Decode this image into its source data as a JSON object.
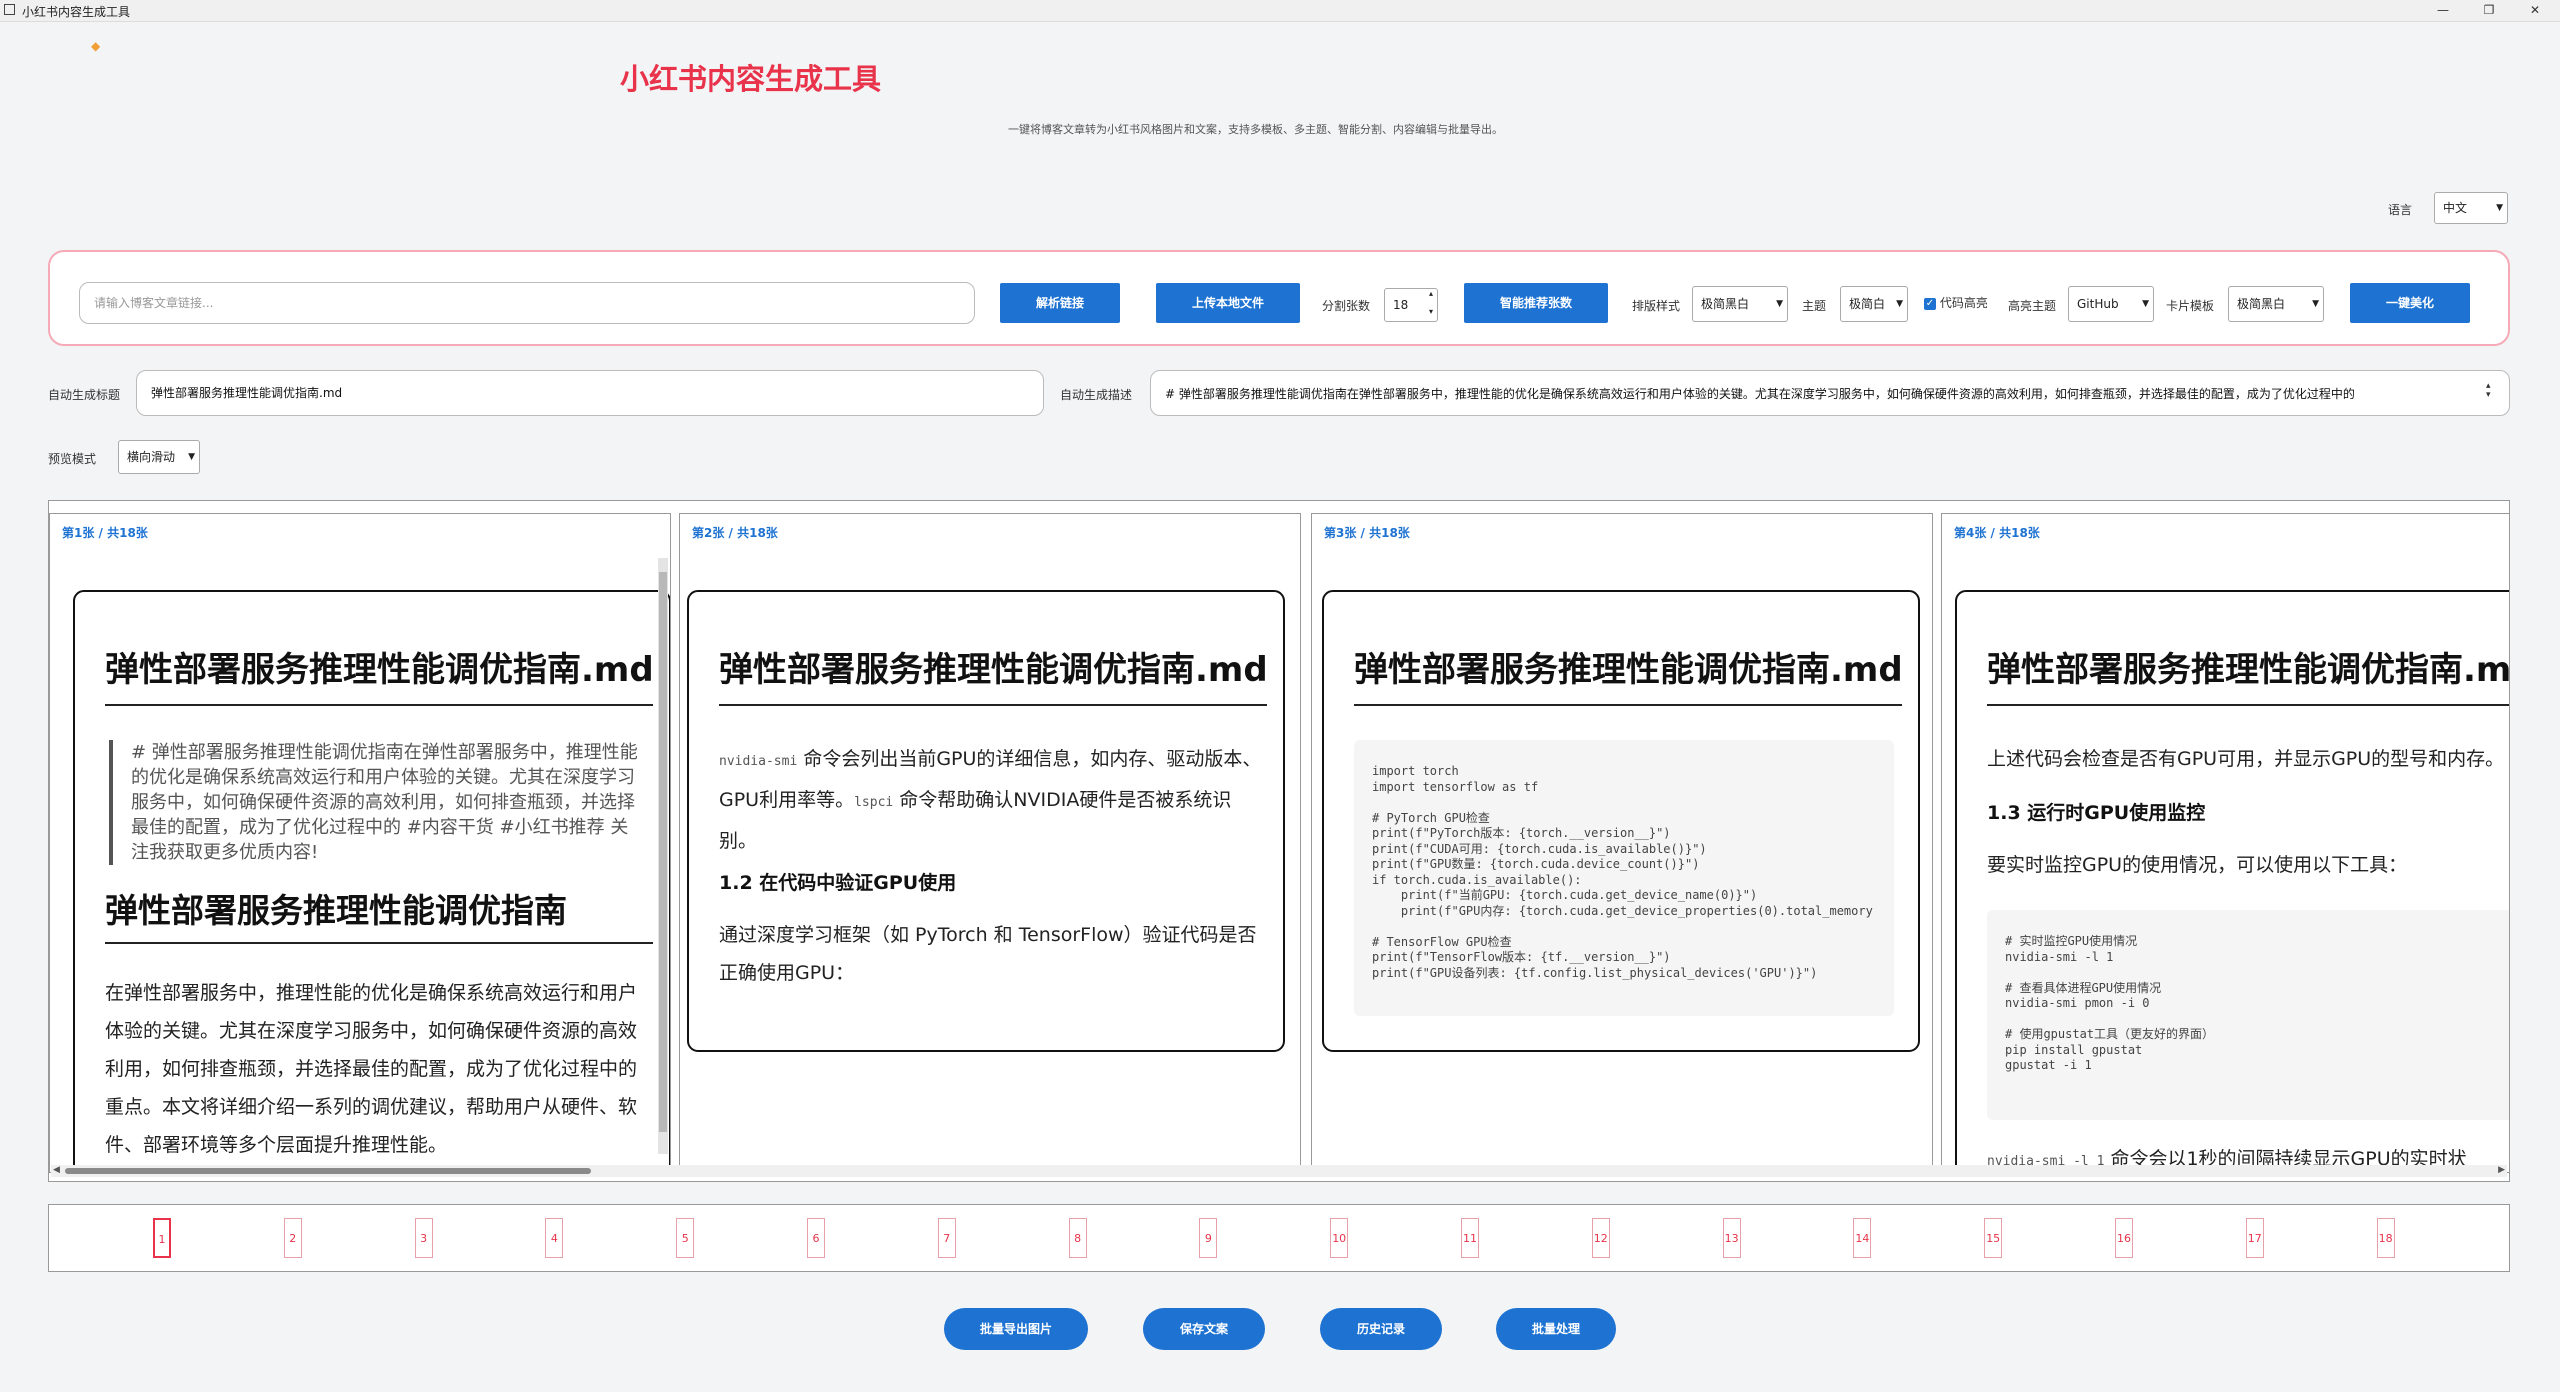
{
  "window": {
    "title": "小红书内容生成工具"
  },
  "header": {
    "logo": "◆",
    "title": "小红书内容生成工具",
    "subtitle": "一键将博客文章转为小红书风格图片和文案，支持多模板、多主题、智能分割、内容编辑与批量导出。"
  },
  "language": {
    "label": "语言",
    "value": "中文"
  },
  "toolbar": {
    "url_placeholder": "请输入博客文章链接...",
    "parse_btn": "解析链接",
    "upload_btn": "上传本地文件",
    "split_label": "分割张数",
    "split_value": "18",
    "recommend_btn": "智能推荐张数",
    "layout_label": "排版样式",
    "layout_value": "极简黑白",
    "theme_label": "主题",
    "theme_value": "极简白",
    "code_highlight_label": "代码高亮",
    "code_highlight_checked": true,
    "hl_theme_label": "高亮主题",
    "hl_theme_value": "GitHub",
    "card_template_label": "卡片模板",
    "card_template_value": "极简黑白",
    "beautify_btn": "一键美化"
  },
  "auto": {
    "title_label": "自动生成标题",
    "title_value": "弹性部署服务推理性能调优指南.md",
    "desc_label": "自动生成描述",
    "desc_value": "# 弹性部署服务推理性能调优指南在弹性部署服务中，推理性能的优化是确保系统高效运行和用户体验的关键。尤其在深度学习服务中，如何确保硬件资源的高效利用，如何排查瓶颈，并选择最佳的配置，成为了优化过程中的"
  },
  "preview_mode": {
    "label": "预览模式",
    "value": "横向滑动"
  },
  "cards": [
    {
      "header": "第1张 / 共18张",
      "title": "弹性部署服务推理性能调优指南.md",
      "quote": "# 弹性部署服务推理性能调优指南在弹性部署服务中，推理性能的优化是确保系统高效运行和用户体验的关键。尤其在深度学习服务中，如何确保硬件资源的高效利用，如何排查瓶颈，并选择最佳的配置，成为了优化过程中的 #内容干货 #小红书推荐 关注我获取更多优质内容!",
      "h2": "弹性部署服务推理性能调优指南",
      "para": "在弹性部署服务中，推理性能的优化是确保系统高效运行和用户体验的关键。尤其在深度学习服务中，如何确保硬件资源的高效利用，如何排查瓶颈，并选择最佳的配置，成为了优化过程中的重点。本文将详细介绍一系列的调优建议，帮助用户从硬件、软件、部署环境等多个层面提升推理性能。"
    },
    {
      "header": "第2张 / 共18张",
      "title": "弹性部署服务推理性能调优指南.md",
      "p1_code1": "nvidia-smi",
      "p1_text1": " 命令会列出当前GPU的详细信息，如内存、驱动版本、GPU利用率等。",
      "p1_code2": "lspci",
      "p1_text2": " 命令帮助确认NVIDIA硬件是否被系统识别。",
      "h3": "1.2 在代码中验证GPU使用",
      "para": "通过深度学习框架（如 PyTorch 和 TensorFlow）验证代码是否正确使用GPU："
    },
    {
      "header": "第3张 / 共18张",
      "title": "弹性部署服务推理性能调优指南.md",
      "code": "import torch\nimport tensorflow as tf\n\n# PyTorch GPU检查\nprint(f\"PyTorch版本: {torch.__version__}\")\nprint(f\"CUDA可用: {torch.cuda.is_available()}\")\nprint(f\"GPU数量: {torch.cuda.device_count()}\")\nif torch.cuda.is_available():\n    print(f\"当前GPU: {torch.cuda.get_device_name(0)}\")\n    print(f\"GPU内存: {torch.cuda.get_device_properties(0).total_memory\n\n# TensorFlow GPU检查\nprint(f\"TensorFlow版本: {tf.__version__}\")\nprint(f\"GPU设备列表: {tf.config.list_physical_devices('GPU')}\")"
    },
    {
      "header": "第4张 / 共18张",
      "title": "弹性部署服务推理性能调优指南.md",
      "p1": "上述代码会检查是否有GPU可用，并显示GPU的型号和内存。",
      "h3": "1.3 运行时GPU使用监控",
      "p2": "要实时监控GPU的使用情况，可以使用以下工具：",
      "code": "# 实时监控GPU使用情况\nnvidia-smi -l 1\n\n# 查看具体进程GPU使用情况\nnvidia-smi pmon -i 0\n\n# 使用gpustat工具（更友好的界面）\npip install gpustat\ngpustat -i 1",
      "p3_code": "nvidia-smi -l 1",
      "p3_text": " 命令会以1秒的间隔持续显示GPU的实时状"
    }
  ],
  "pages": [
    "1",
    "2",
    "3",
    "4",
    "5",
    "6",
    "7",
    "8",
    "9",
    "10",
    "11",
    "12",
    "13",
    "14",
    "15",
    "16",
    "17",
    "18"
  ],
  "active_page": 1,
  "bottom": {
    "export_btn": "批量导出图片",
    "save_btn": "保存文案",
    "history_btn": "历史记录",
    "batch_btn": "批量处理"
  },
  "colors": {
    "accent": "#e8334a",
    "primary": "#1e73d2",
    "panel_border": "#f6aab8"
  }
}
